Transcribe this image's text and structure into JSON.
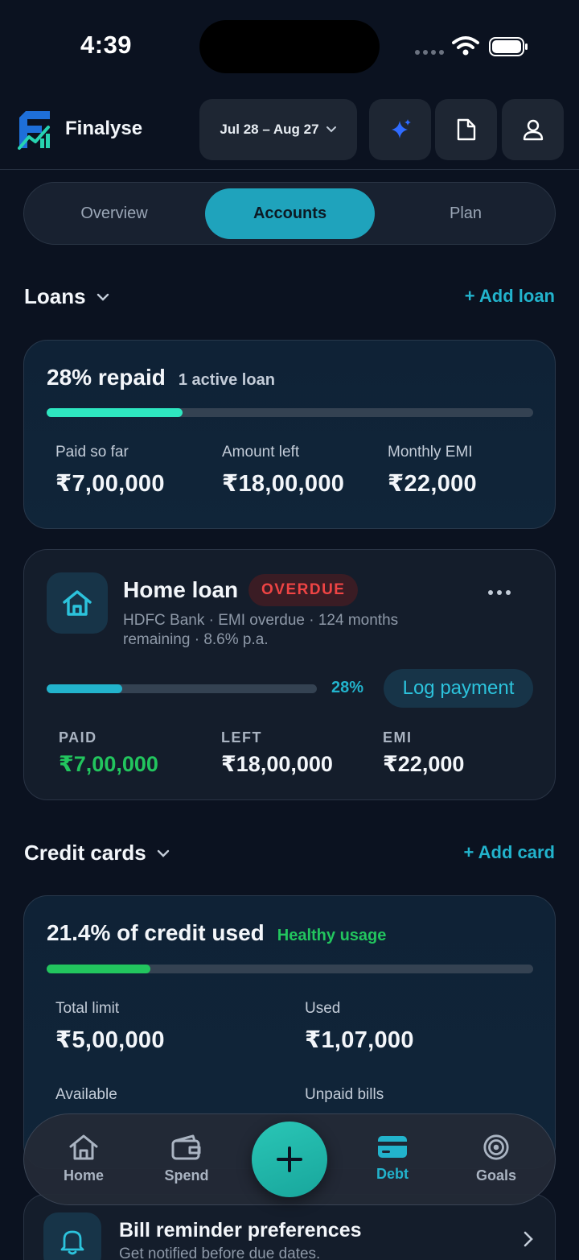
{
  "status": {
    "time": "4:39"
  },
  "header": {
    "brand": "Finalyse",
    "date_range": "Jul 28 – Aug 27",
    "icons": [
      "sparkle-icon",
      "document-icon",
      "user-icon"
    ]
  },
  "tabs": [
    {
      "label": "Overview",
      "active": false
    },
    {
      "label": "Accounts",
      "active": true
    },
    {
      "label": "Plan",
      "active": false
    }
  ],
  "loans": {
    "title": "Loans",
    "add_label": "+ Add loan",
    "summary": {
      "headline": "28% repaid",
      "sub": "1 active loan",
      "progress": 0.28,
      "stats": [
        {
          "label": "Paid so far",
          "value": "₹7,00,000"
        },
        {
          "label": "Amount left",
          "value": "₹18,00,000"
        },
        {
          "label": "Monthly EMI",
          "value": "₹22,000"
        }
      ]
    },
    "items": [
      {
        "name": "Home loan",
        "badge": "OVERDUE",
        "desc_line1": "HDFC Bank · EMI overdue · 124 months",
        "desc_line2": "remaining · 8.6% p.a.",
        "progress": 0.28,
        "progress_label": "28%",
        "action": "Log payment",
        "paid_label": "PAID",
        "paid_value": "₹7,00,000",
        "left_label": "LEFT",
        "left_value": "₹18,00,000",
        "emi_label": "EMI",
        "emi_value": "₹22,000"
      }
    ]
  },
  "credit_cards": {
    "title": "Credit cards",
    "add_label": "+ Add card",
    "summary": {
      "headline": "21.4% of credit used",
      "status": "Healthy usage",
      "progress": 0.214,
      "total_label": "Total limit",
      "total_value": "₹5,00,000",
      "used_label": "Used",
      "used_value": "₹1,07,000",
      "available_label": "Available",
      "unpaid_label": "Unpaid bills"
    }
  },
  "reminder": {
    "title": "Bill reminder preferences",
    "sub": "Get notified before due dates."
  },
  "nav": {
    "items": [
      {
        "label": "Home",
        "icon": "home-icon",
        "active": false
      },
      {
        "label": "Spend",
        "icon": "wallet-icon",
        "active": false
      },
      {
        "label": "Debt",
        "icon": "card-icon",
        "active": true
      },
      {
        "label": "Goals",
        "icon": "target-icon",
        "active": false
      }
    ]
  },
  "colors": {
    "accent": "#1fa3bc",
    "loan_progress": "#2ee6c0",
    "credit_progress": "#22c55e",
    "overdue": "#ef4444",
    "paid_green": "#22c55e"
  }
}
